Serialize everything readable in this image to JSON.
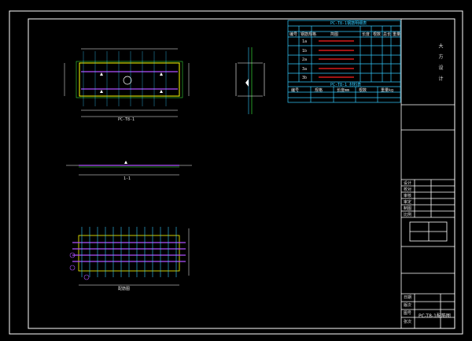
{
  "drawing": {
    "title_block": {
      "sheet_name": "PC-T8-1配筋图",
      "company_mark": "大  方  设  计",
      "rows": [
        "设计",
        "校对",
        "审核",
        "审定",
        "制图",
        "比例",
        "日期"
      ],
      "header_cols": [
        "",
        "",
        ""
      ],
      "small_labels": [
        "版次",
        "图号",
        "张次"
      ]
    },
    "rebar_table": {
      "title": "PC-T8-1钢筋明细表",
      "header": [
        "编号",
        "钢筋规格",
        "简图",
        "长度",
        "根数",
        "总长",
        "重量"
      ],
      "rows": [
        "1a",
        "1b",
        "2a",
        "3a",
        "3b"
      ],
      "subtitle": "PC-T8-1 材料表",
      "footer": [
        "编号",
        "规格",
        "长度mm",
        "根数",
        "重量kg"
      ]
    },
    "views": {
      "plan_label": "PC-T8-1",
      "section_label": "1-1",
      "rebar_label": "配筋图"
    },
    "colors": {
      "frame": "#ffffff",
      "cyan": "#33ccff",
      "yellow": "#ffff00",
      "red": "#ff2020",
      "magenta": "#b050ff",
      "green": "#40ff40",
      "background": "#000000"
    }
  }
}
